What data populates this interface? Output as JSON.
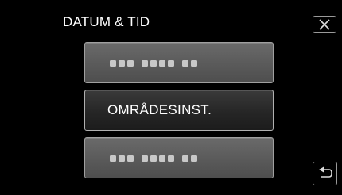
{
  "header": {
    "title": "DATUM & TID",
    "close_icon": "close-icon"
  },
  "menu": {
    "items": [
      {
        "label": "",
        "placeholder_icon": "dotted-text-icon",
        "selected": false
      },
      {
        "label": "OMRÅDESINST.",
        "selected": true
      },
      {
        "label": "",
        "placeholder_icon": "dotted-text-icon",
        "selected": false
      }
    ]
  },
  "footer": {
    "back_icon": "back-return-icon"
  },
  "colors": {
    "background": "#000000",
    "button_border": "#a0a0a0",
    "button_fill": "#5a5a5a",
    "selected_fill": "#262626",
    "text": "#ffffff"
  }
}
